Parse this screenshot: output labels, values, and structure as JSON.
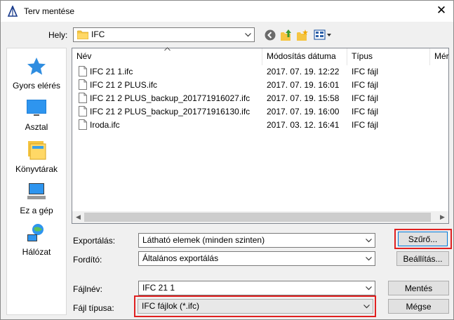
{
  "window": {
    "title": "Terv mentése",
    "close_glyph": "✕"
  },
  "location": {
    "label": "Hely:",
    "value": "IFC"
  },
  "places": [
    {
      "label": "Gyors elérés",
      "icon": "quick-access-icon"
    },
    {
      "label": "Asztal",
      "icon": "desktop-icon"
    },
    {
      "label": "Könyvtárak",
      "icon": "libraries-icon"
    },
    {
      "label": "Ez a gép",
      "icon": "this-pc-icon"
    },
    {
      "label": "Hálózat",
      "icon": "network-icon"
    }
  ],
  "filelist": {
    "columns": [
      "Név",
      "Módosítás dátuma",
      "Típus",
      "Mér"
    ],
    "rows": [
      {
        "name": "IFC 21 1.ifc",
        "date": "2017. 07. 19. 12:22",
        "type": "IFC fájl"
      },
      {
        "name": "IFC 21 2 PLUS.ifc",
        "date": "2017. 07. 19. 16:01",
        "type": "IFC fájl"
      },
      {
        "name": "IFC 21 2 PLUS_backup_201771916027.ifc",
        "date": "2017. 07. 19. 15:58",
        "type": "IFC fájl"
      },
      {
        "name": "IFC 21 2 PLUS_backup_201771916130.ifc",
        "date": "2017. 07. 19. 16:00",
        "type": "IFC fájl"
      },
      {
        "name": "Iroda.ifc",
        "date": "2017. 03. 12. 16:41",
        "type": "IFC fájl"
      }
    ]
  },
  "export": {
    "label": "Exportálás:",
    "value": "Látható elemek (minden szinten)",
    "filter_button": "Szűrő..."
  },
  "translator": {
    "label": "Fordító:",
    "value": "Általános exportálás",
    "settings_button": "Beállítás..."
  },
  "filename": {
    "label": "Fájlnév:",
    "value": "IFC 21 1",
    "save_button": "Mentés"
  },
  "filetype": {
    "label": "Fájl típusa:",
    "value": "IFC fájlok (*.ifc)",
    "cancel_button": "Mégse"
  },
  "colors": {
    "highlight": "#e02020",
    "accent": "#0078d7"
  }
}
